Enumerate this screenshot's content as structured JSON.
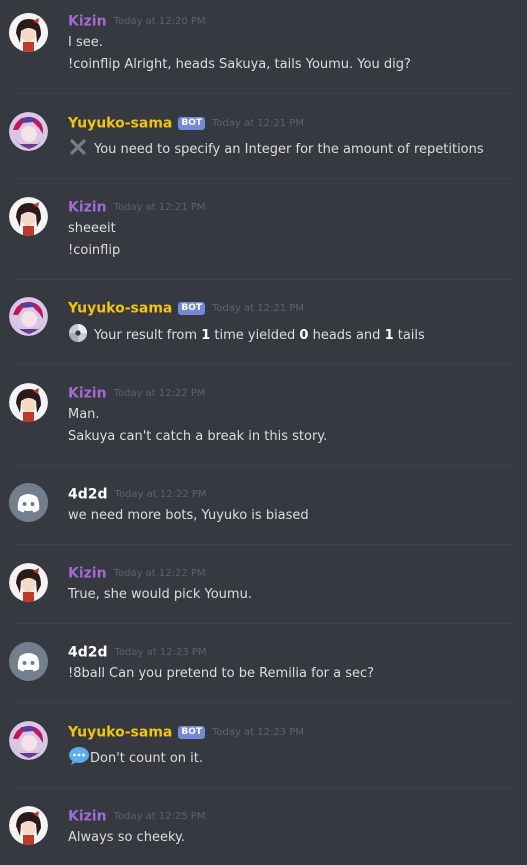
{
  "messages": [
    {
      "author": "Kizin",
      "role": "kizin",
      "bot": false,
      "timestamp": "Today at 12:20 PM",
      "lines": [
        "I see.",
        "!coinflip Alright, heads Sakuya, tails Youmu. You dig?"
      ]
    },
    {
      "author": "Yuyuko-sama",
      "role": "yuyuko",
      "bot": true,
      "bot_label": "BOT",
      "timestamp": "Today at 12:21 PM",
      "emoji": "cross-mark-icon",
      "lines": [
        "You need to specify an Integer for the amount of repetitions"
      ]
    },
    {
      "author": "Kizin",
      "role": "kizin",
      "bot": false,
      "timestamp": "Today at 12:21 PM",
      "lines": [
        "sheeeit",
        "!coinflip"
      ]
    },
    {
      "author": "Yuyuko-sama",
      "role": "yuyuko",
      "bot": true,
      "bot_label": "BOT",
      "timestamp": "Today at 12:21 PM",
      "emoji": "disc-icon",
      "result": {
        "p1": "Your result from ",
        "n1": "1",
        "p2": " time yielded ",
        "n2": "0",
        "p3": " heads and ",
        "n3": "1",
        "p4": " tails"
      }
    },
    {
      "author": "Kizin",
      "role": "kizin",
      "bot": false,
      "timestamp": "Today at 12:22 PM",
      "lines": [
        "Man.",
        "Sakuya can't catch a break in this story."
      ]
    },
    {
      "author": "4d2d",
      "role": "user",
      "bot": false,
      "timestamp": "Today at 12:22 PM",
      "lines": [
        "we need more bots, Yuyuko is biased"
      ]
    },
    {
      "author": "Kizin",
      "role": "kizin",
      "bot": false,
      "timestamp": "Today at 12:22 PM",
      "lines": [
        "True, she would pick Youmu."
      ]
    },
    {
      "author": "4d2d",
      "role": "user",
      "bot": false,
      "timestamp": "Today at 12:23 PM",
      "lines": [
        "!8ball Can you pretend to be Remilia for a sec?"
      ]
    },
    {
      "author": "Yuyuko-sama",
      "role": "yuyuko",
      "bot": true,
      "bot_label": "BOT",
      "timestamp": "Today at 12:23 PM",
      "emoji": "speech-balloon-icon",
      "lines": [
        "Don't count on it."
      ]
    },
    {
      "author": "Kizin",
      "role": "kizin",
      "bot": false,
      "timestamp": "Today at 12:25 PM",
      "lines": [
        "Always so cheeky."
      ]
    }
  ],
  "colors": {
    "background": "#36393f",
    "kizin": "#a36ad6",
    "yuyuko": "#f1c40f",
    "user": "#ffffff",
    "bot_tag": "#7289da",
    "timestamp": "#5f6268"
  }
}
